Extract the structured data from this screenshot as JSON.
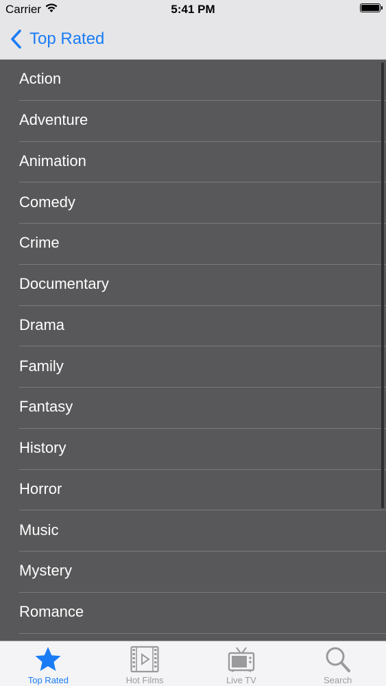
{
  "status_bar": {
    "carrier": "Carrier",
    "time": "5:41 PM"
  },
  "nav": {
    "back_label": "Top Rated"
  },
  "genres": [
    "Action",
    "Adventure",
    "Animation",
    "Comedy",
    "Crime",
    "Documentary",
    "Drama",
    "Family",
    "Fantasy",
    "History",
    "Horror",
    "Music",
    "Mystery",
    "Romance"
  ],
  "tabs": [
    {
      "label": "Top Rated",
      "icon": "star-icon",
      "active": true
    },
    {
      "label": "Hot Films",
      "icon": "film-icon",
      "active": false
    },
    {
      "label": "Live TV",
      "icon": "tv-icon",
      "active": false
    },
    {
      "label": "Search",
      "icon": "search-icon",
      "active": false
    }
  ],
  "colors": {
    "accent": "#1a7cf5",
    "list_background": "#585759",
    "bar_background": "#e6e6e8",
    "tab_inactive": "#9a9a9c"
  }
}
